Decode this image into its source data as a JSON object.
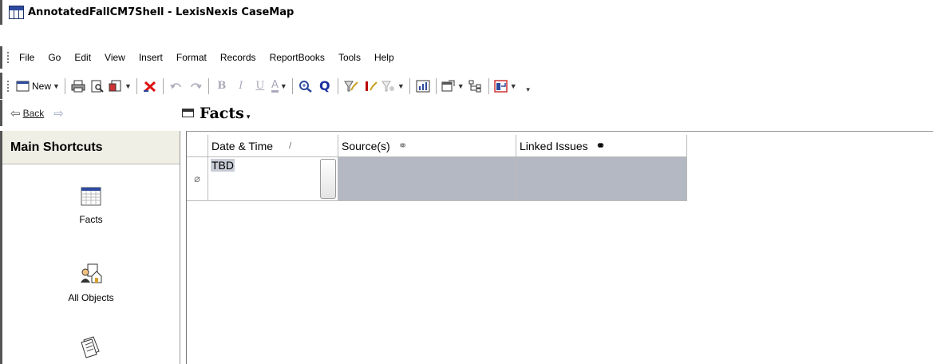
{
  "window": {
    "title": "AnnotatedFallCM7Shell - LexisNexis CaseMap"
  },
  "menu": {
    "items": [
      "File",
      "Go",
      "Edit",
      "View",
      "Insert",
      "Format",
      "Records",
      "ReportBooks",
      "Tools",
      "Help"
    ]
  },
  "toolbar": {
    "new_label": "New",
    "icons": [
      "new-record-icon",
      "print-icon",
      "print-preview-icon",
      "report-icon",
      "delete-icon",
      "undo-icon",
      "redo-icon",
      "bold-icon",
      "italic-icon",
      "underline-icon",
      "font-color-icon",
      "zoom-icon",
      "search-icon",
      "filter-icon",
      "tag-icon",
      "clear-filter-icon",
      "chart-icon",
      "spreadsheet-icon",
      "hierarchy-icon",
      "export-icon"
    ]
  },
  "nav": {
    "back_label": "Back",
    "view_title": "Facts"
  },
  "sidebar": {
    "header": "Main Shortcuts",
    "shortcuts": [
      {
        "label": "Facts",
        "icon": "facts-grid-icon"
      },
      {
        "label": "All Objects",
        "icon": "all-objects-icon"
      },
      {
        "label": "",
        "icon": "documents-icon"
      }
    ]
  },
  "grid": {
    "columns": [
      {
        "label": "Date & Time",
        "indicator": "/"
      },
      {
        "label": "Source(s)",
        "indicator": "link"
      },
      {
        "label": "Linked Issues",
        "indicator": "link"
      }
    ],
    "rows": [
      {
        "date_time": "TBD",
        "sources": "",
        "linked_issues": ""
      }
    ]
  },
  "colors": {
    "row_selected": "#b4b8c2",
    "navbar_bg": "#ffffff",
    "sidebar_header_bg": "#f0efe6"
  }
}
